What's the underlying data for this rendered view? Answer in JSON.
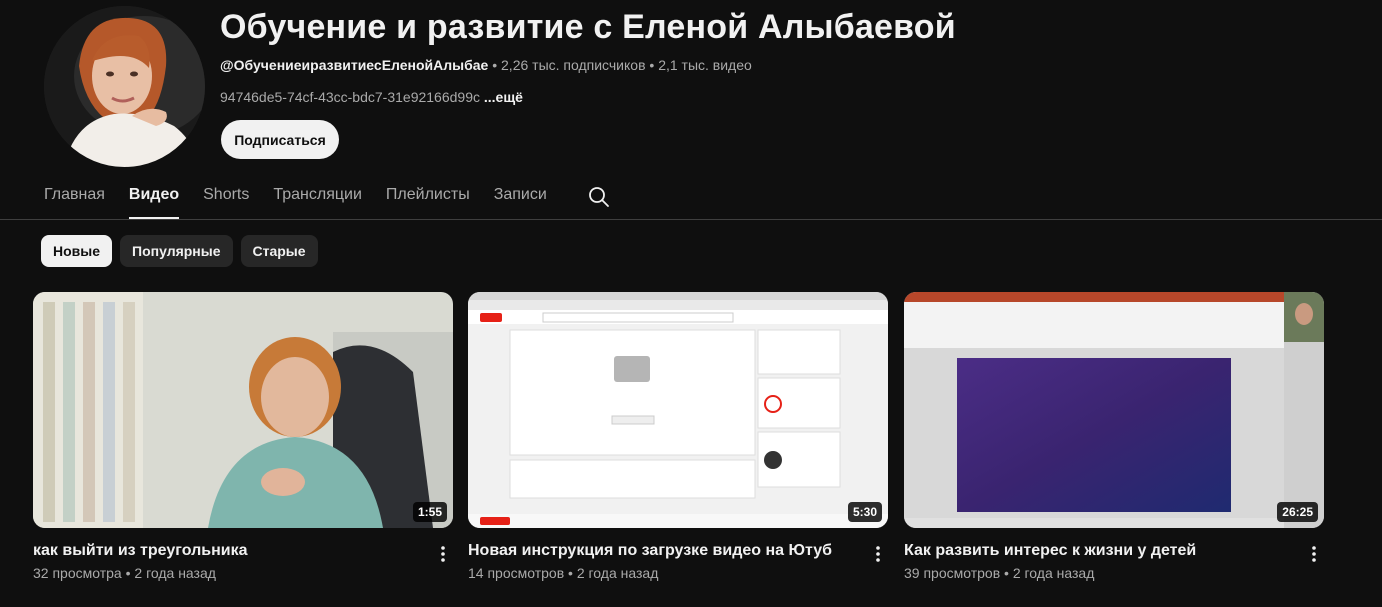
{
  "channel": {
    "title": "Обучение и развитие с Еленой Алыбаевой",
    "handle": "@ОбучениеиразвитиесЕленойАлыбае",
    "subscribers": "2,26 тыс. подписчиков",
    "videos_count": "2,1 тыс. видео",
    "separator": "•",
    "description": "94746de5-74cf-43cc-bdc7-31e92166d99c",
    "more": "...ещё",
    "subscribe_label": "Подписаться"
  },
  "tabs": [
    {
      "label": "Главная",
      "active": false
    },
    {
      "label": "Видео",
      "active": true
    },
    {
      "label": "Shorts",
      "active": false
    },
    {
      "label": "Трансляции",
      "active": false
    },
    {
      "label": "Плейлисты",
      "active": false
    },
    {
      "label": "Записи",
      "active": false
    }
  ],
  "chips": [
    {
      "label": "Новые",
      "active": true
    },
    {
      "label": "Популярные",
      "active": false
    },
    {
      "label": "Старые",
      "active": false
    }
  ],
  "videos": [
    {
      "title": "как выйти из треугольника",
      "views": "32 просмотра",
      "age": "2 года назад",
      "duration": "1:55"
    },
    {
      "title": "Новая инструкция по загрузке видео на Ютуб",
      "views": "14 просмотров",
      "age": "2 года назад",
      "duration": "5:30"
    },
    {
      "title": "Как развить интерес к жизни у детей",
      "views": "39 просмотров",
      "age": "2 года назад",
      "duration": "26:25"
    }
  ],
  "icons": {
    "search": "search-icon",
    "kebab": "more-vert-icon"
  },
  "colors": {
    "background": "#0f0f0f",
    "text": "#f1f1f1",
    "secondary_text": "#aaaaaa",
    "chip": "#272727"
  }
}
